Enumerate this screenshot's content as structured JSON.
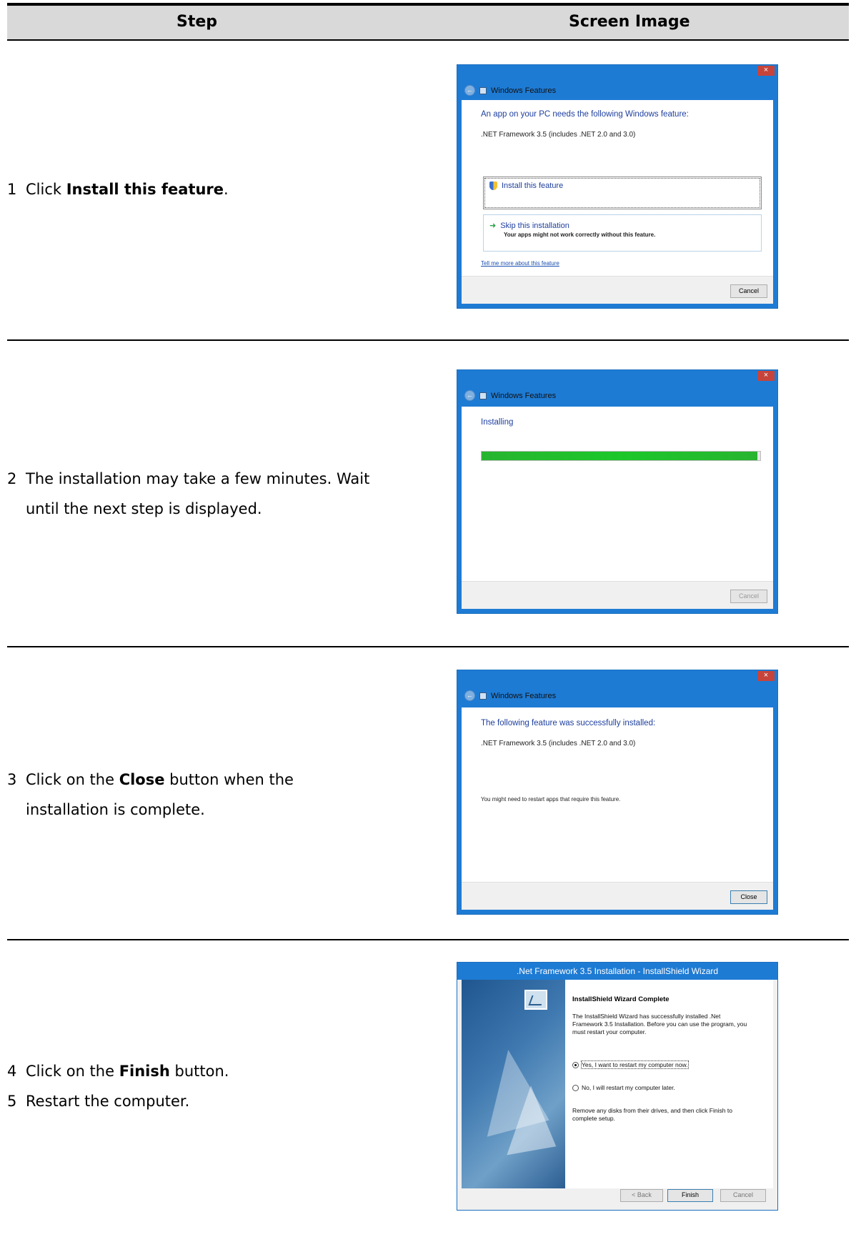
{
  "header": {
    "step": "Step",
    "screen_image": "Screen Image"
  },
  "rows": [
    {
      "num": "1",
      "line1_pre": "Click ",
      "line1_bold": "Install this feature",
      "line1_post": "."
    },
    {
      "num": "2",
      "line1": "The installation may take a few minutes. Wait",
      "line2": "until the next step is displayed."
    },
    {
      "num": "3",
      "line1_pre": "Click on the ",
      "line1_bold": "Close",
      "line1_post": " button when the",
      "line2": "installation is complete."
    },
    {
      "num": "4",
      "line1_pre": "Click on the ",
      "line1_bold": "Finish",
      "line1_post": " button."
    },
    {
      "num": "5",
      "line1": "Restart the computer."
    }
  ],
  "dialog1": {
    "title": "Windows Features",
    "close": "×",
    "heading": "An app on your PC needs the following Windows feature:",
    "feature": ".NET Framework 3.5 (includes .NET 2.0 and 3.0)",
    "option1": "Install this feature",
    "option2_title": "Skip this installation",
    "option2_sub": "Your apps might not work correctly without this feature.",
    "link": "Tell me more about this feature",
    "cancel": "Cancel"
  },
  "dialog2": {
    "title": "Windows Features",
    "close": "×",
    "heading": "Installing",
    "progress": 0.99,
    "cancel": "Cancel"
  },
  "dialog3": {
    "title": "Windows Features",
    "close": "×",
    "heading": "The following feature was successfully installed:",
    "feature": ".NET Framework 3.5 (includes .NET 2.0 and 3.0)",
    "note": "You might need to restart apps that require this feature.",
    "close_btn": "Close"
  },
  "wizard": {
    "title": ".Net Framework 3.5 Installation - InstallShield Wizard",
    "heading": "InstallShield Wizard Complete",
    "para": "The InstallShield Wizard has successfully installed .Net Framework 3.5 Installation.  Before you can use the program, you must restart your computer.",
    "radio_yes": "Yes, I want to restart my computer now.",
    "radio_no": "No, I will restart my computer later.",
    "para2": "Remove any disks from their drives, and then click Finish to complete setup.",
    "back": "< Back",
    "finish": "Finish",
    "cancel": "Cancel"
  }
}
